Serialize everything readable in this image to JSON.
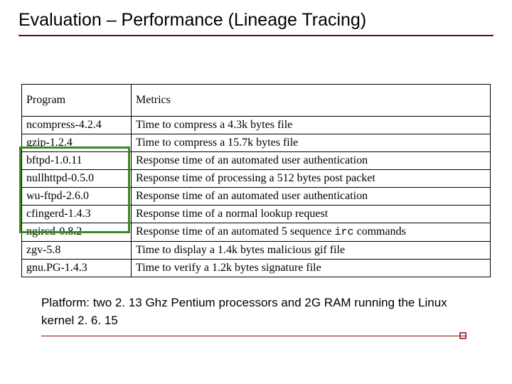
{
  "title": "Evaluation – Performance (Lineage Tracing)",
  "table": {
    "headers": {
      "program": "Program",
      "metrics": "Metrics"
    },
    "rows": [
      {
        "program": "ncompress-4.2.4",
        "metrics": "Time to compress a 4.3k bytes file"
      },
      {
        "program": "gzip-1.2.4",
        "metrics": "Time to compress a 15.7k bytes file"
      },
      {
        "program": "bftpd-1.0.11",
        "metrics": "Response time of an automated user authentication"
      },
      {
        "program": "nullhttpd-0.5.0",
        "metrics": "Response time of processing a 512 bytes post packet"
      },
      {
        "program": "wu-ftpd-2.6.0",
        "metrics": "Response time of an automated user authentication"
      },
      {
        "program": "cfingerd-1.4.3",
        "metrics": "Response time of a normal lookup request"
      },
      {
        "program": "ngircd-0.8.2",
        "metrics_pre": "Response time of an automated 5 sequence ",
        "metrics_code": "irc",
        "metrics_post": " commands"
      },
      {
        "program": "zgv-5.8",
        "metrics": "Time to display a 1.4k bytes malicious gif file"
      },
      {
        "program": "gnu.PG-1.4.3",
        "metrics": "Time to verify a 1.2k bytes signature file"
      }
    ]
  },
  "platform": "Platform: two 2. 13 Ghz Pentium processors and 2G RAM running the Linux kernel 2. 6. 15"
}
